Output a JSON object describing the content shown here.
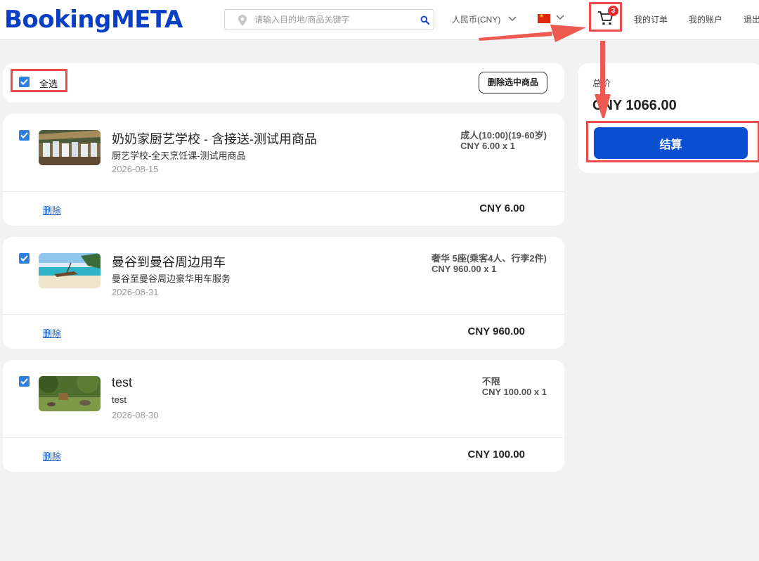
{
  "header": {
    "logo": "BookingMETA",
    "search_placeholder": "请输入目的地/商品关键字",
    "currency": "人民币(CNY)",
    "cart_count": "3",
    "nav": [
      "我的订单",
      "我的账户",
      "退出"
    ]
  },
  "cart": {
    "select_all_label": "全选",
    "delete_selected_label": "删除选中商品",
    "delete_label": "删除",
    "items": [
      {
        "title": "奶奶家厨艺学校 - 含接送-测试用商品",
        "subtitle": "厨艺学校-全天烹饪课-测试用商品",
        "date": "2026-08-15",
        "option": "成人(10:00)(19-60岁)",
        "unit_price": "CNY 6.00 x 1",
        "subtotal": "CNY 6.00"
      },
      {
        "title": "曼谷到曼谷周边用车",
        "subtitle": "曼谷至曼谷周边豪华用车服务",
        "date": "2026-08-31",
        "option": "奢华 5座(乘客4人、行李2件)",
        "unit_price": "CNY 960.00 x 1",
        "subtotal": "CNY 960.00"
      },
      {
        "title": "test",
        "subtitle": "test",
        "date": "2026-08-30",
        "option": "不限",
        "unit_price": "CNY 100.00 x 1",
        "subtotal": "CNY 100.00"
      }
    ]
  },
  "summary": {
    "total_label": "总价",
    "total_amount": "CNY 1066.00",
    "checkout_label": "结算"
  },
  "colors": {
    "brand": "#0a3fc4",
    "checkout": "#0a4fd1",
    "annotation": "#ee4b4b",
    "checkbox": "#2f7fe0"
  }
}
